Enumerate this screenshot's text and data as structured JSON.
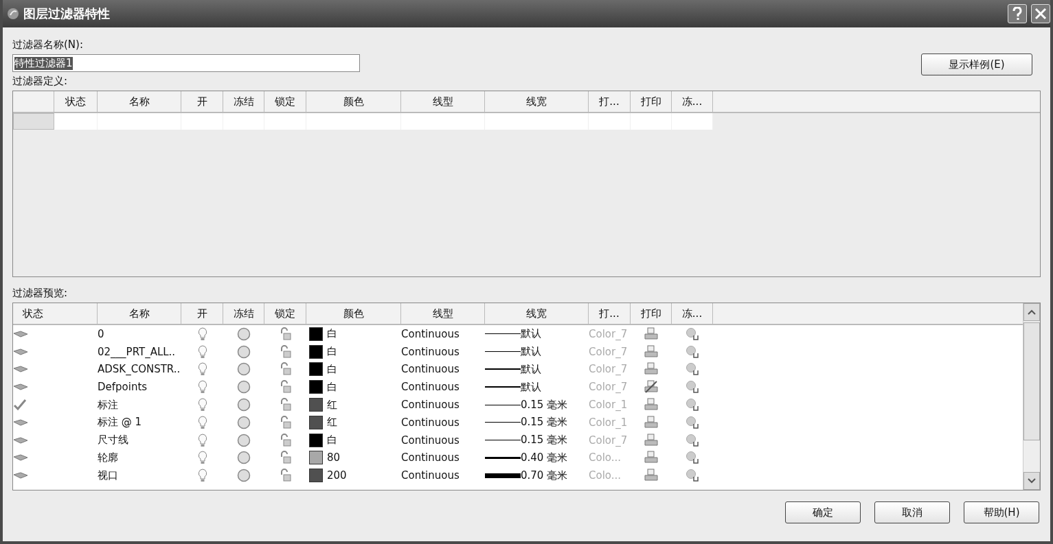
{
  "window": {
    "title": "图层过滤器特性"
  },
  "filter_name": {
    "label": "过滤器名称(N):",
    "value": "特性过滤器1",
    "selected": true
  },
  "legend_button": "显示样例(E)",
  "definition": {
    "label": "过滤器定义:",
    "columns": [
      "状态",
      "名称",
      "开",
      "冻结",
      "锁定",
      "颜色",
      "线型",
      "线宽",
      "打...",
      "打印",
      "冻..."
    ]
  },
  "preview": {
    "label": "过滤器预览:",
    "columns": [
      "状态",
      "名称",
      "开",
      "冻结",
      "锁定",
      "颜色",
      "线型",
      "线宽",
      "打...",
      "打印",
      "冻..."
    ],
    "rows": [
      {
        "kind": "layer",
        "name": "0",
        "color": "#000000",
        "color_name": "白",
        "linetype": "Continuous",
        "lineweight": {
          "kind": "thin",
          "text": "默认"
        },
        "plot_style": "Color_7",
        "plot": true
      },
      {
        "kind": "layer",
        "name": "02___PRT_ALL..",
        "color": "#000000",
        "color_name": "白",
        "linetype": "Continuous",
        "lineweight": {
          "kind": "thin",
          "text": "默认"
        },
        "plot_style": "Color_7",
        "plot": true
      },
      {
        "kind": "layer",
        "name": "ADSK_CONSTR..",
        "color": "#000000",
        "color_name": "白",
        "linetype": "Continuous",
        "lineweight": {
          "kind": "medium",
          "text": "默认"
        },
        "plot_style": "Color_7",
        "plot": true
      },
      {
        "kind": "layer",
        "name": "Defpoints",
        "color": "#000000",
        "color_name": "白",
        "linetype": "Continuous",
        "lineweight": {
          "kind": "medium",
          "text": "默认"
        },
        "plot_style": "Color_7",
        "plot": false
      },
      {
        "kind": "current",
        "name": "标注",
        "color": "#505050",
        "color_name": "红",
        "linetype": "Continuous",
        "lineweight": {
          "kind": "thin",
          "text": "0.15 毫米"
        },
        "plot_style": "Color_1",
        "plot": true
      },
      {
        "kind": "layer",
        "name": "标注 @ 1",
        "color": "#505050",
        "color_name": "红",
        "linetype": "Continuous",
        "lineweight": {
          "kind": "thin",
          "text": "0.15 毫米"
        },
        "plot_style": "Color_1",
        "plot": true
      },
      {
        "kind": "layer",
        "name": "尺寸线",
        "color": "#000000",
        "color_name": "白",
        "linetype": "Continuous",
        "lineweight": {
          "kind": "thin",
          "text": "0.15 毫米"
        },
        "plot_style": "Color_7",
        "plot": true
      },
      {
        "kind": "layer",
        "name": "轮廓",
        "color": "#a8a8a8",
        "color_name": "80",
        "linetype": "Continuous",
        "lineweight": {
          "kind": "bold",
          "text": "0.40 毫米"
        },
        "plot_style": "Colo...",
        "plot": true
      },
      {
        "kind": "layer",
        "name": "视口",
        "color": "#505050",
        "color_name": "200",
        "linetype": "Continuous",
        "lineweight": {
          "kind": "heavy",
          "text": "0.70 毫米"
        },
        "plot_style": "Colo...",
        "plot": true
      }
    ]
  },
  "buttons": [
    "确定",
    "取消",
    "帮助(H)"
  ]
}
